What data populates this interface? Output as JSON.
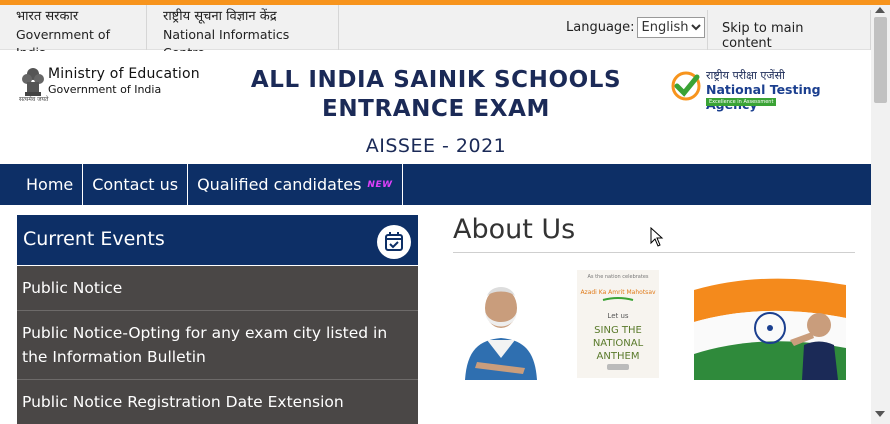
{
  "gov_bar": {
    "cells": [
      {
        "hindi": "भारत सरकार",
        "english": "Government of India"
      },
      {
        "hindi": "राष्ट्रीय सूचना विज्ञान केंद्र",
        "english": "National Informatics Centre"
      }
    ],
    "language_label": "Language:",
    "language_selected": "English",
    "skip_link": "Skip to main content"
  },
  "header": {
    "ministry": {
      "name": "Ministry of Education",
      "sub": "Government of India",
      "motto": "सत्यमेव जयते"
    },
    "title_line1": "ALL INDIA SAINIK SCHOOLS",
    "title_line2": "ENTRANCE EXAM",
    "subtitle": "AISSEE - 2021",
    "nta": {
      "hindi": "राष्ट्रीय परीक्षा एजेंसी",
      "english": "National Testing Agency",
      "tagline": "Excellence in Assessment"
    }
  },
  "nav": {
    "items": [
      {
        "label": "Home"
      },
      {
        "label": "Contact us"
      },
      {
        "label": "Qualified candidates",
        "badge": "NEW"
      }
    ]
  },
  "current_events": {
    "title": "Current Events",
    "items": [
      "Public Notice",
      "Public Notice-Opting for any exam city listed in the Information Bulletin",
      "Public Notice Registration Date Extension"
    ]
  },
  "about": {
    "title": "About Us",
    "anthem_image": {
      "line1": "As the nation celebrates",
      "line2": "Azadi Ka Amrit Mahotsav",
      "line3": "Let us",
      "line4": "SING THE",
      "line5": "NATIONAL",
      "line6": "ANTHEM"
    }
  },
  "colors": {
    "accent_orange": "#f7941d",
    "navy": "#0d2f66",
    "title_navy": "#1b2a57",
    "events_bg": "#4a4746"
  }
}
